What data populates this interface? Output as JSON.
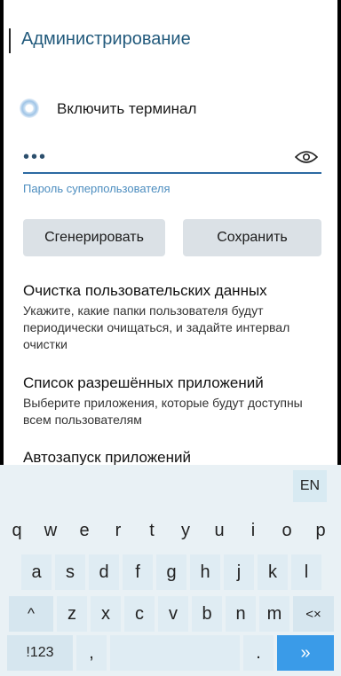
{
  "header": {
    "title": "Администрирование"
  },
  "terminal": {
    "toggle_label": "Включить терминал"
  },
  "password": {
    "value": "•••",
    "hint": "Пароль суперпользователя"
  },
  "buttons": {
    "generate": "Сгенерировать",
    "save": "Сохранить"
  },
  "sections": [
    {
      "title": "Очистка пользовательских данных",
      "desc": "Укажите, какие папки пользователя будут периодически очищаться, и задайте интервал очистки"
    },
    {
      "title": "Список разрешённых приложений",
      "desc": "Выберите приложения, которые будут доступны всем пользователям"
    },
    {
      "title": "Автозапуск приложений"
    }
  ],
  "keyboard": {
    "lang": "EN",
    "row1": [
      "q",
      "w",
      "e",
      "r",
      "t",
      "y",
      "u",
      "i",
      "o",
      "p"
    ],
    "row2": [
      "a",
      "s",
      "d",
      "f",
      "g",
      "h",
      "j",
      "k",
      "l"
    ],
    "row3": [
      "z",
      "x",
      "c",
      "v",
      "b",
      "n",
      "m"
    ],
    "shift": "^",
    "backspace": "<×",
    "numbers": "!123",
    "comma": ",",
    "period": ".",
    "enter": "»"
  },
  "colors": {
    "accent": "#2c6aa2",
    "title": "#225a7c",
    "enter": "#3a9be8"
  }
}
